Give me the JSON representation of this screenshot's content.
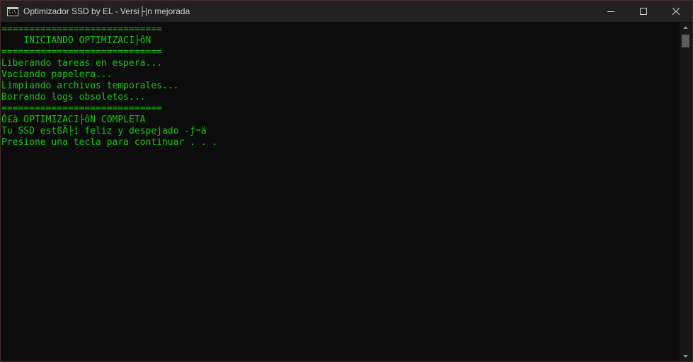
{
  "window": {
    "title": "Optimizador SSD by EL - Versi├|n mejorada",
    "icon": "console-icon",
    "icon_text": "C:\\"
  },
  "console": {
    "lines": [
      "=============================",
      "    INICIANDO OPTIMIZACI├ôN",
      "=============================",
      "Liberando tareas en espera...",
      "Vaciando papelera...",
      "Limpiando archivos temporales...",
      "Borrando logs obsoletos...",
      "=============================",
      "Ô£à OPTIMIZACI├ôN COMPLETA",
      "Tu SSD estßÄ├í feliz y despejado -ƒ¬ä",
      "Presione una tecla para continuar . . ."
    ],
    "text_color": "#16c60c",
    "background": "#0c0c0c"
  }
}
